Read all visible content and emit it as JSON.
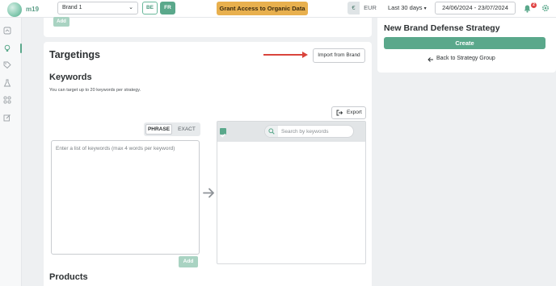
{
  "topbar": {
    "logo_text": "m19",
    "brand_select": "Brand 1",
    "lang_be": "BE",
    "lang_fr": "FR",
    "access_button": "Grant Access to Organic Data",
    "currency_symbol": "€",
    "currency_code": "EUR",
    "period_select": "Last 30 days",
    "date_range": "24/06/2024 - 23/07/2024",
    "notification_count": "2"
  },
  "top_panel": {
    "add_label": "Add"
  },
  "targetings": {
    "title": "Targetings",
    "import_button": "Import from Brand",
    "keywords_title": "Keywords",
    "keywords_note": "You can target up to 20 keywords per strategy.",
    "export_button": "Export",
    "match_types": [
      "PHRASE",
      "EXACT"
    ],
    "match_selected": "PHRASE",
    "textarea_placeholder": "Enter a list of keywords (max 4 words per keyword)",
    "add_button": "Add",
    "search_placeholder": "Search by keywords",
    "products_title": "Products"
  },
  "right_panel": {
    "title": "New Brand Defense Strategy",
    "create_button": "Create",
    "back_link": "Back to Strategy Group"
  },
  "colors": {
    "accent": "#5aa88b",
    "accent_light": "#a9d3c2",
    "access_button": "#e8b04e",
    "annotation_arrow": "#d9443c",
    "notification_badge": "#e04545"
  },
  "icons": {
    "sidebar": [
      "dashboard-icon",
      "lightbulb-icon",
      "tag-icon",
      "flask-icon",
      "puzzle-icon",
      "edit-icon"
    ],
    "bell": "bell-icon",
    "settings": "gear-icon",
    "export": "export-icon",
    "search": "search-icon",
    "transfer": "arrow-right-icon",
    "back": "arrow-left-icon"
  }
}
